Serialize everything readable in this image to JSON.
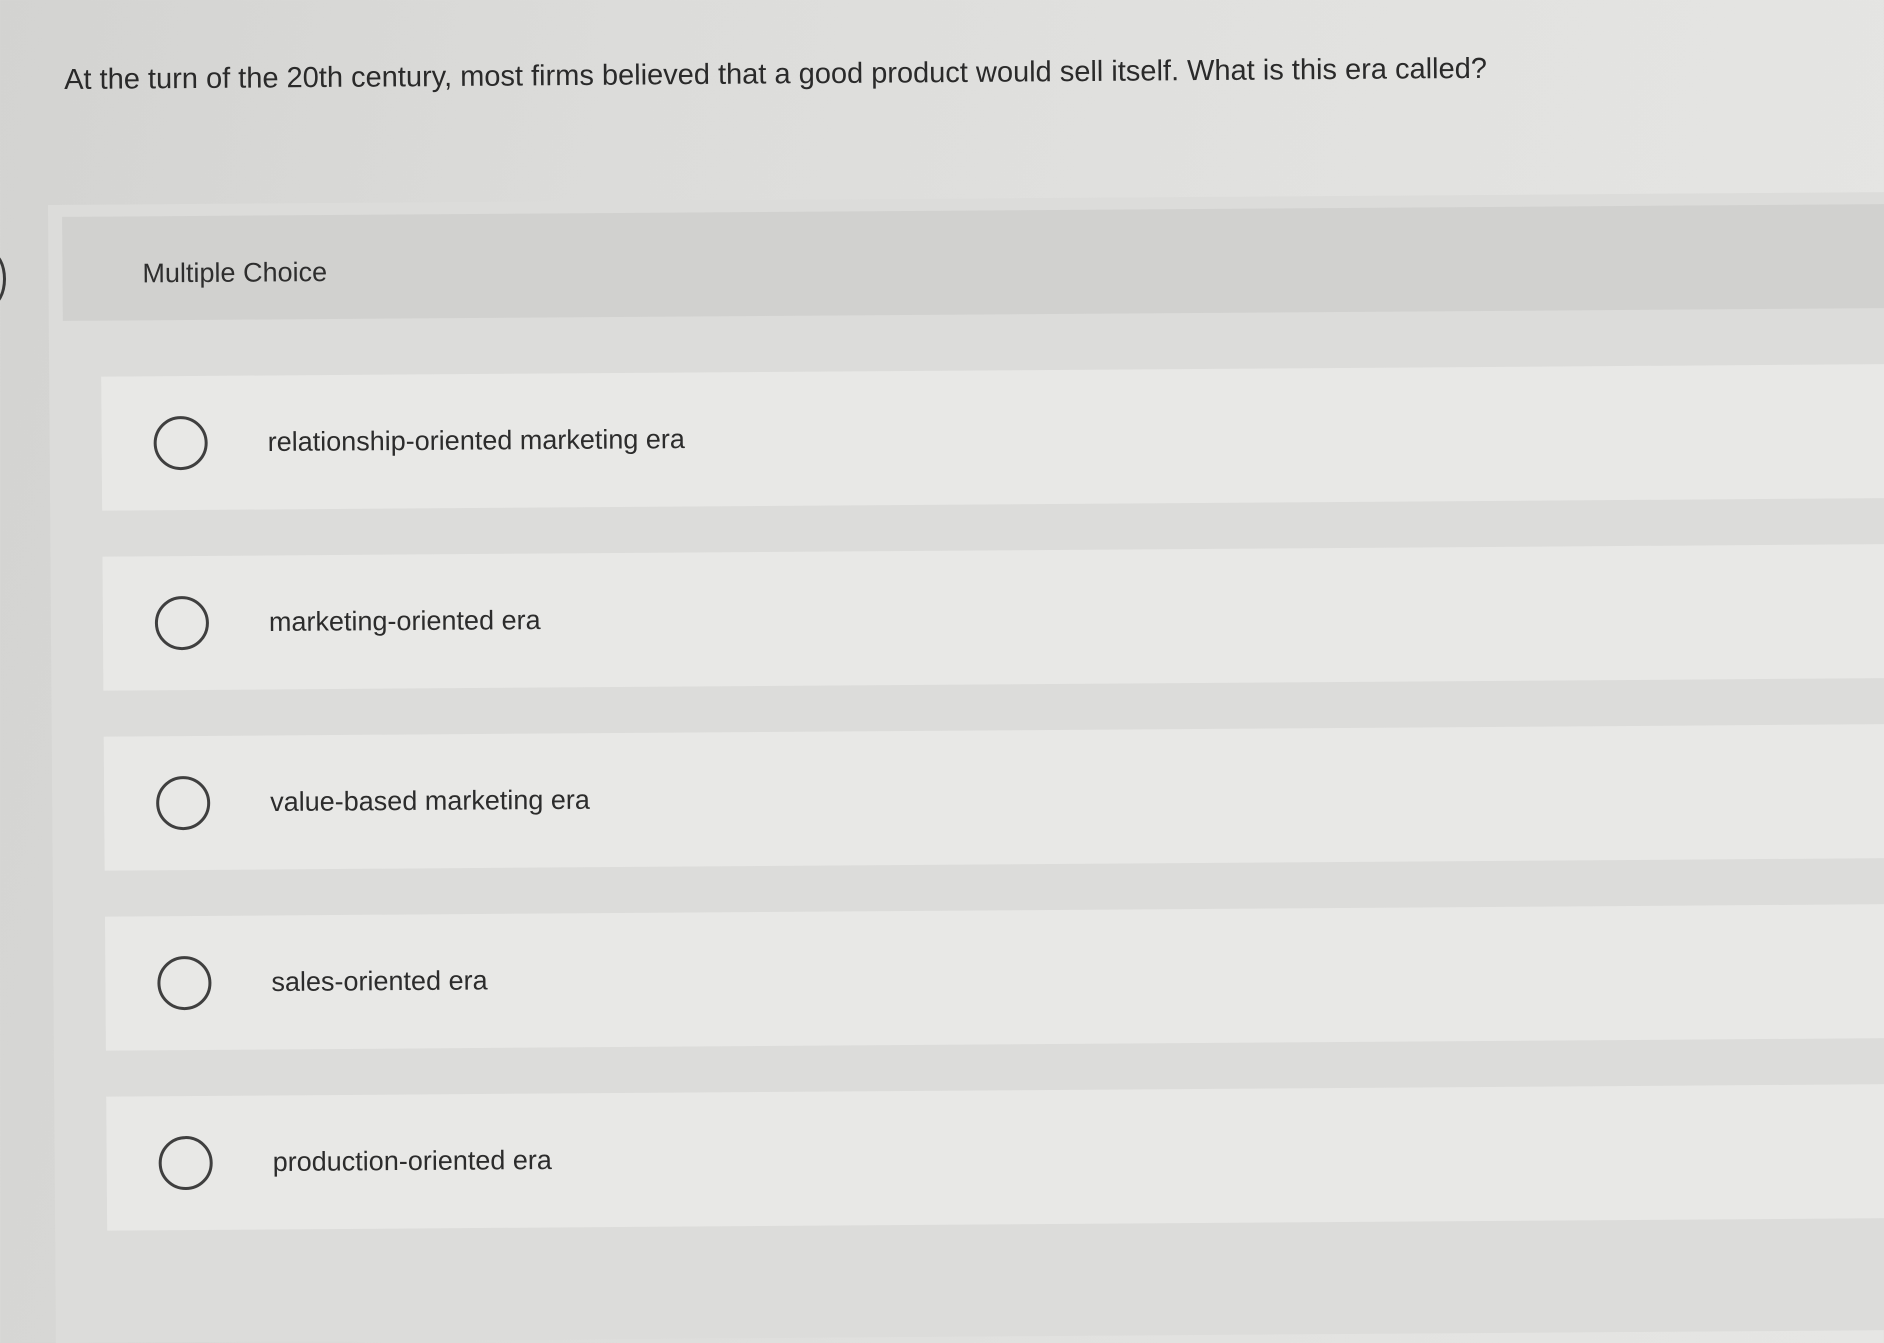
{
  "question": {
    "text": "At the turn of the 20th century, most firms believed that a good product would sell itself. What is this era called?"
  },
  "panel": {
    "title": "Multiple Choice"
  },
  "options": [
    {
      "label": "relationship-oriented marketing era",
      "selected": false
    },
    {
      "label": "marketing-oriented era",
      "selected": false
    },
    {
      "label": "value-based marketing era",
      "selected": false
    },
    {
      "label": "sales-oriented era",
      "selected": false
    },
    {
      "label": "production-oriented era",
      "selected": false
    }
  ],
  "colors": {
    "background": "#dcdcda",
    "header": "#d1d1cf",
    "option": "#e8e8e6",
    "text": "#2c2c2c",
    "radio_border": "#3f3f3f"
  }
}
